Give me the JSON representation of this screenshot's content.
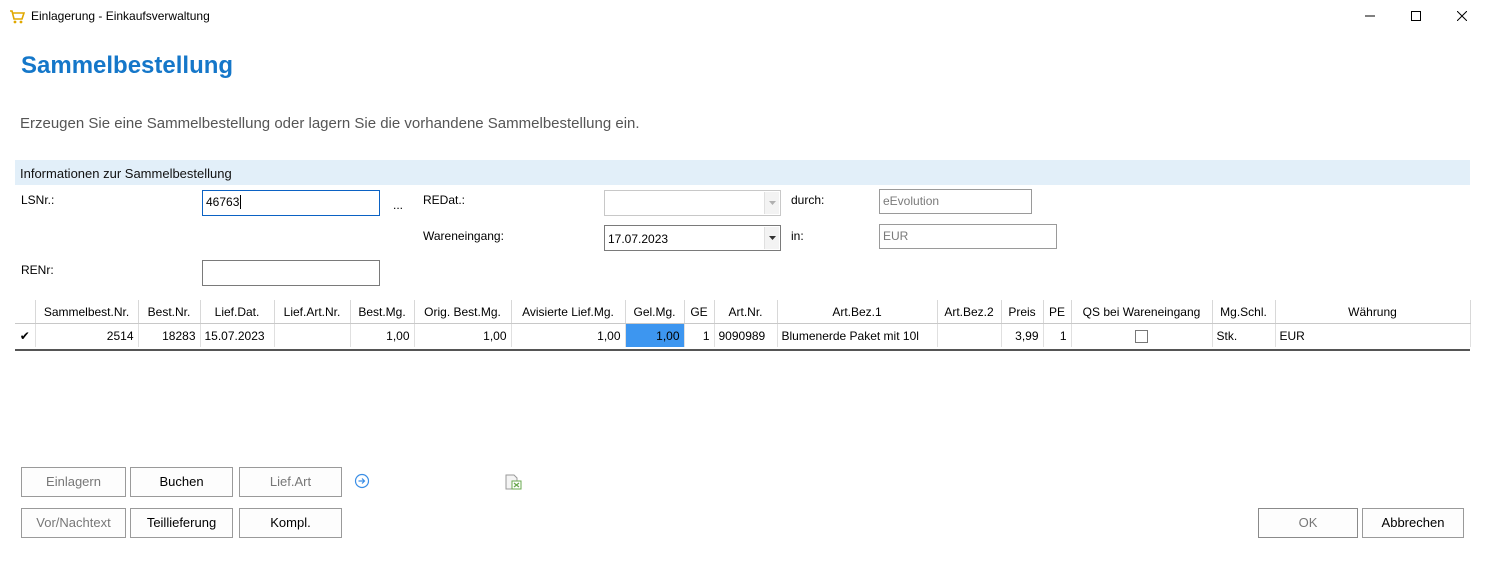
{
  "window": {
    "title": "Einlagerung - Einkaufsverwaltung",
    "accent": "#1577c9"
  },
  "header": {
    "title": "Sammelbestellung",
    "subtitle": "Erzeugen Sie eine Sammelbestellung oder lagern Sie die vorhandene Sammelbestellung ein."
  },
  "info": {
    "section_title": "Informationen zur Sammelbestellung",
    "lsnr_label": "LSNr.:",
    "lsnr_value": "46763",
    "ellipsis": "...",
    "renr_label": "RENr:",
    "renr_value": "",
    "redat_label": "REDat.:",
    "redat_value": "",
    "wareneingang_label": "Wareneingang:",
    "wareneingang_value": "17.07.2023",
    "durch_label": "durch:",
    "durch_value": "eEvolution",
    "in_label": "in:",
    "in_value": "EUR"
  },
  "grid": {
    "columns": [
      "Sammelbest.Nr.",
      "Best.Nr.",
      "Lief.Dat.",
      "Lief.Art.Nr.",
      "Best.Mg.",
      "Orig. Best.Mg.",
      "Avisierte Lief.Mg.",
      "Gel.Mg.",
      "GE",
      "Art.Nr.",
      "Art.Bez.1",
      "Art.Bez.2",
      "Preis",
      "PE",
      "QS bei Wareneingang",
      "Mg.Schl.",
      "Währung"
    ],
    "rows": [
      {
        "marker": "✔",
        "sammelbest_nr": "2514",
        "best_nr": "18283",
        "lief_dat": "15.07.2023",
        "lief_art_nr": "",
        "best_mg": "1,00",
        "orig_best_mg": "1,00",
        "avis_lief_mg": "1,00",
        "gel_mg": "1,00",
        "ge": "1",
        "art_nr": "9090989",
        "art_bez_1": "Blumenerde Paket mit 10l",
        "art_bez_2": "",
        "preis": "3,99",
        "pe": "1",
        "qs_checked": false,
        "mg_schl": "Stk.",
        "waehrung": "EUR"
      }
    ]
  },
  "buttons": {
    "einlagern": "Einlagern",
    "buchen": "Buchen",
    "lief_art": "Lief.Art",
    "vor_nachtext": "Vor/Nachtext",
    "teillieferung": "Teillieferung",
    "kompl": "Kompl.",
    "ok": "OK",
    "abbrechen": "Abbrechen"
  }
}
